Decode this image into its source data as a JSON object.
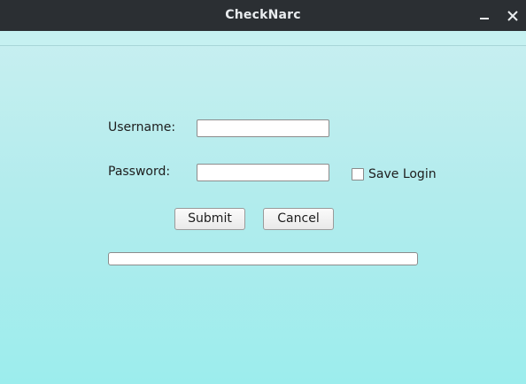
{
  "window": {
    "title": "CheckNarc",
    "minimize_icon": "minimize-icon",
    "close_icon": "close-icon"
  },
  "form": {
    "username_label": "Username:",
    "username_value": "",
    "password_label": "Password:",
    "password_value": "",
    "save_login_label": "Save Login",
    "save_login_checked": false,
    "submit_label": "Submit",
    "cancel_label": "Cancel",
    "progress_fraction": 0
  },
  "colors": {
    "titlebar": "#2b2f33",
    "background": "#9feeee"
  }
}
